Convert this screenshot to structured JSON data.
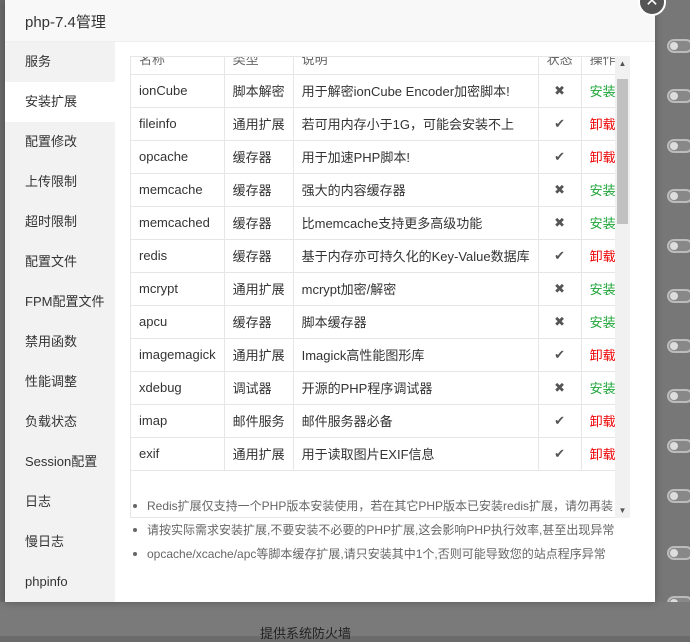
{
  "dialog": {
    "title": "php-7.4管理",
    "close_icon": "close-icon"
  },
  "sidebar": {
    "items": [
      {
        "label": "服务"
      },
      {
        "label": "安装扩展",
        "active": true
      },
      {
        "label": "配置修改"
      },
      {
        "label": "上传限制"
      },
      {
        "label": "超时限制"
      },
      {
        "label": "配置文件"
      },
      {
        "label": "FPM配置文件"
      },
      {
        "label": "禁用函数"
      },
      {
        "label": "性能调整"
      },
      {
        "label": "负载状态"
      },
      {
        "label": "Session配置"
      },
      {
        "label": "日志"
      },
      {
        "label": "慢日志"
      },
      {
        "label": "phpinfo"
      }
    ]
  },
  "table": {
    "headers": {
      "name": "名称",
      "type": "类型",
      "desc": "说明",
      "status": "状态",
      "op": "操作"
    },
    "rows": [
      {
        "name": "ionCube",
        "type": "脚本解密",
        "desc": "用于解密ionCube Encoder加密脚本!",
        "status": "✖",
        "op": "安装",
        "installed": false
      },
      {
        "name": "fileinfo",
        "type": "通用扩展",
        "desc": "若可用内存小于1G，可能会安装不上",
        "status": "✔",
        "op": "卸载",
        "installed": true
      },
      {
        "name": "opcache",
        "type": "缓存器",
        "desc": "用于加速PHP脚本!",
        "status": "✔",
        "op": "卸载",
        "installed": true
      },
      {
        "name": "memcache",
        "type": "缓存器",
        "desc": "强大的内容缓存器",
        "status": "✖",
        "op": "安装",
        "installed": false
      },
      {
        "name": "memcached",
        "type": "缓存器",
        "desc": "比memcache支持更多高级功能",
        "status": "✖",
        "op": "安装",
        "installed": false
      },
      {
        "name": "redis",
        "type": "缓存器",
        "desc": "基于内存亦可持久化的Key-Value数据库",
        "status": "✔",
        "op": "卸载",
        "installed": true
      },
      {
        "name": "mcrypt",
        "type": "通用扩展",
        "desc": "mcrypt加密/解密",
        "status": "✖",
        "op": "安装",
        "installed": false
      },
      {
        "name": "apcu",
        "type": "缓存器",
        "desc": "脚本缓存器",
        "status": "✖",
        "op": "安装",
        "installed": false
      },
      {
        "name": "imagemagick",
        "type": "通用扩展",
        "desc": "Imagick高性能图形库",
        "status": "✔",
        "op": "卸载",
        "installed": true
      },
      {
        "name": "xdebug",
        "type": "调试器",
        "desc": "开源的PHP程序调试器",
        "status": "✖",
        "op": "安装",
        "installed": false
      },
      {
        "name": "imap",
        "type": "邮件服务",
        "desc": "邮件服务器必备",
        "status": "✔",
        "op": "卸载",
        "installed": true
      },
      {
        "name": "exif",
        "type": "通用扩展",
        "desc": "用于读取图片EXIF信息",
        "status": "✔",
        "op": "卸载",
        "installed": true
      }
    ]
  },
  "notes": [
    "Redis扩展仅支持一个PHP版本安装使用，若在其它PHP版本已安装redis扩展，请勿再装",
    "请按实际需求安装扩展,不要安装不必要的PHP扩展,这会影响PHP执行效率,甚至出现异常",
    "opcache/xcache/apc等脚本缓存扩展,请只安装其中1个,否则可能导致您的站点程序异常"
  ],
  "background": {
    "bottom_text": "提供系统防火墙"
  },
  "colors": {
    "install": "#20a53a",
    "uninstall": "#e00000",
    "sidebar_bg": "#f2f2f2"
  }
}
